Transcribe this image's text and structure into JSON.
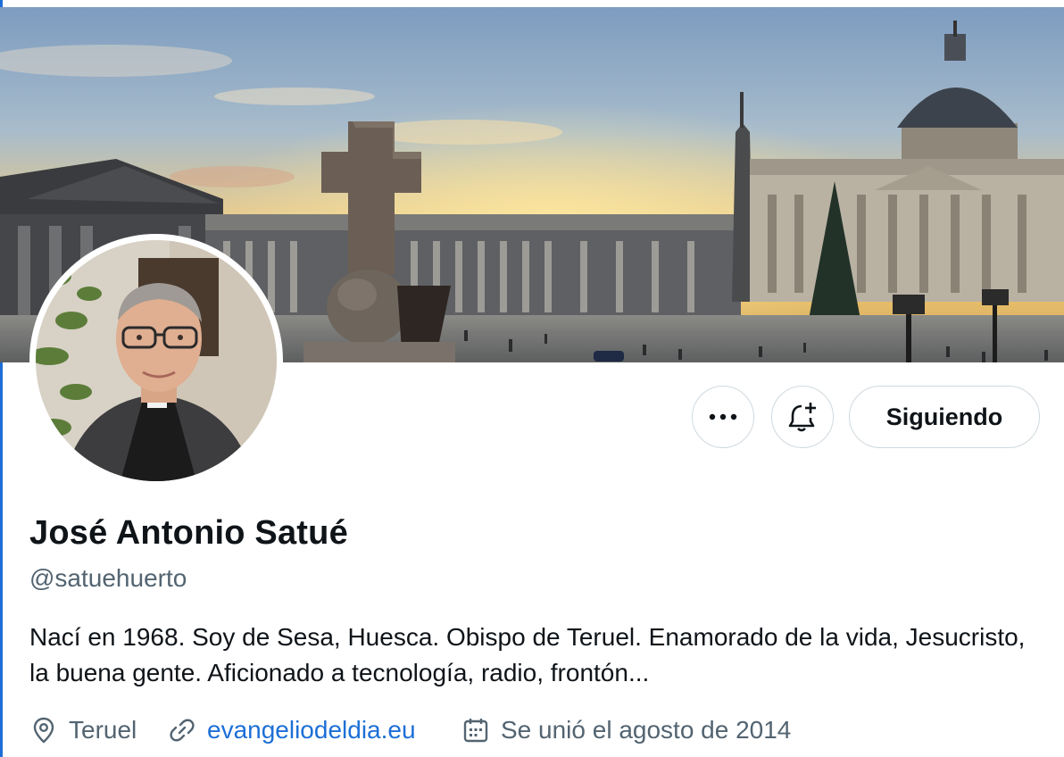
{
  "profile": {
    "name": "José Antonio Satué",
    "handle": "@satuehuerto",
    "bio": "Nací en 1968. Soy de Sesa, Huesca. Obispo de Teruel. Enamorado de la vida, Jesucristo, la buena gente. Aficionado a tecnología, radio, frontón...",
    "location": "Teruel",
    "website": "evangeliodeldia.eu",
    "joined": "Se unió el agosto de 2014"
  },
  "actions": {
    "following_label": "Siguiendo"
  },
  "icons": {
    "more": "more-horizontal-icon",
    "notify": "bell-plus-icon",
    "location": "location-pin-icon",
    "link": "link-icon",
    "calendar": "calendar-icon"
  },
  "colors": {
    "link": "#1d6fd6",
    "secondary_text": "#536471",
    "border": "#cfd9de"
  }
}
